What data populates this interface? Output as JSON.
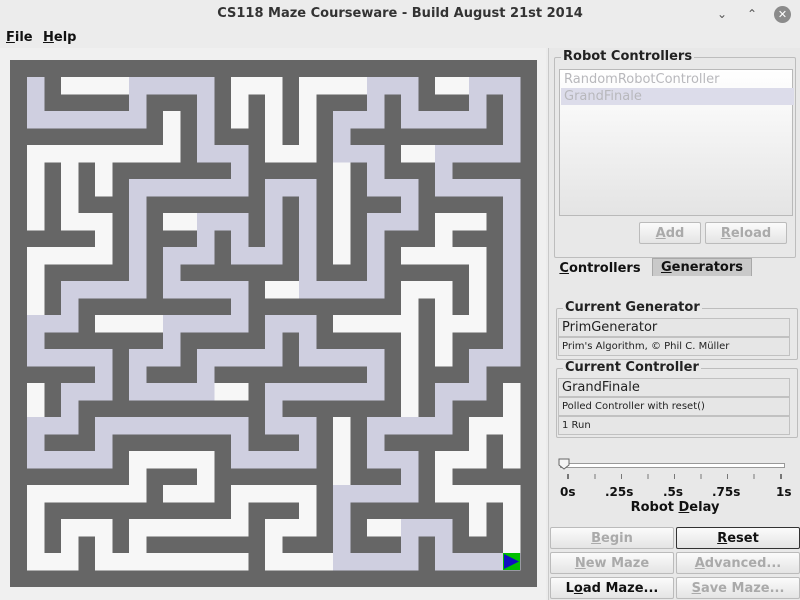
{
  "window": {
    "title": "CS118 Maze Courseware - Build August 21st 2014",
    "minimize_glyph": "⌄",
    "maximize_glyph": "⌃",
    "close_glyph": "✕"
  },
  "menu": {
    "file_mnemonic": "F",
    "file_rest": "ile",
    "help_mnemonic": "H",
    "help_rest": "elp"
  },
  "maze": {
    "cells": 15,
    "wall_color": "#666666",
    "path_color": "#f7f7f7",
    "trail_color": "#cfcfe0",
    "start_color": "#cfcfe0",
    "finish_color": "#00c000",
    "robot_color": "#1010c0",
    "robot_icon": "triangle-right"
  },
  "robot_controllers": {
    "legend": "Robot Controllers",
    "items": [
      "RandomRobotController",
      "GrandFinale"
    ],
    "selected_index": 1,
    "add_label_mnemonic": "A",
    "add_label_rest": "dd",
    "reload_label_mnemonic": "R",
    "reload_label_rest": "eload"
  },
  "tabs": {
    "controllers_mnemonic": "C",
    "controllers_rest": "ontrollers",
    "generators_mnemonic": "G",
    "generators_rest": "enerators"
  },
  "current_generator": {
    "legend": "Current Generator",
    "name": "PrimGenerator",
    "description": "Prim's Algorithm, © Phil C. Müller"
  },
  "current_controller": {
    "legend": "Current Controller",
    "name": "GrandFinale",
    "description": "Polled Controller with reset()",
    "runs": "1 Run"
  },
  "delay": {
    "ticks": [
      "0s",
      ".25s",
      ".5s",
      ".75s",
      "1s"
    ],
    "label_pre": "Robot ",
    "label_mnemonic": "D",
    "label_post": "elay",
    "value_fraction": 0
  },
  "actions": {
    "begin_mnemonic": "B",
    "begin_rest": "egin",
    "reset_mnemonic": "R",
    "reset_rest": "eset",
    "new_maze_mnemonic": "N",
    "new_maze_rest": "ew Maze",
    "advanced_mnemonic": "A",
    "advanced_rest": "dvanced...",
    "load_maze_pre": "L",
    "load_maze_mnemonic": "o",
    "load_maze_rest": "ad Maze...",
    "save_maze_mnemonic": "S",
    "save_maze_rest": "ave Maze..."
  }
}
